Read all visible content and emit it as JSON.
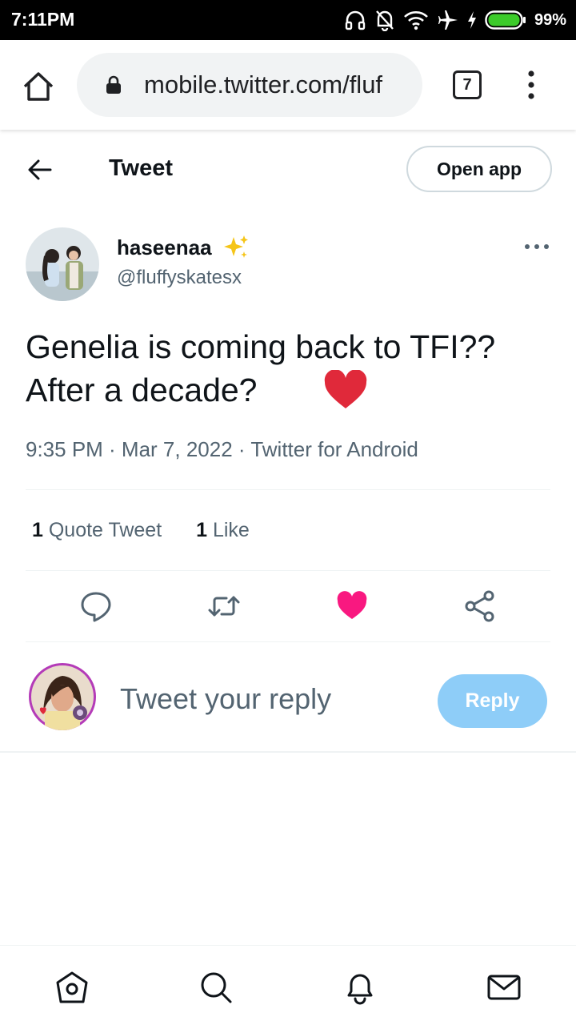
{
  "status_bar": {
    "time": "7:11PM",
    "battery_percent": "99%",
    "icons": [
      "headphones-icon",
      "notifications-off-icon",
      "wifi-icon",
      "airplane-icon",
      "charging-icon",
      "battery-icon"
    ]
  },
  "browser": {
    "url": "mobile.twitter.com/fluf",
    "tab_count": "7",
    "icons": [
      "home-icon",
      "lock-icon",
      "menu-icon"
    ]
  },
  "header": {
    "title": "Tweet",
    "open_app_label": "Open app"
  },
  "tweet": {
    "author_name": "haseenaa",
    "author_handle": "@fluffyskatesx",
    "text_line1": "Genelia is coming back to TFI??",
    "text_line2": "After a decade?",
    "meta": "9:35 PM · Mar 7, 2022 · Twitter for Android",
    "quote_count": "1",
    "quote_label": "Quote Tweet",
    "like_count": "1",
    "like_label": "Like"
  },
  "actions": [
    "reply-icon",
    "retweet-icon",
    "like-icon",
    "share-icon"
  ],
  "reply": {
    "placeholder": "Tweet your reply",
    "button_label": "Reply"
  },
  "bottom_nav": [
    "home-nav-icon",
    "search-nav-icon",
    "notifications-nav-icon",
    "messages-nav-icon"
  ],
  "colors": {
    "like_pink": "#f91880",
    "heart_red": "#e0293a",
    "reply_button": "#8ecdf8",
    "secondary_text": "#536471",
    "battery_green": "#3ccb2a"
  }
}
